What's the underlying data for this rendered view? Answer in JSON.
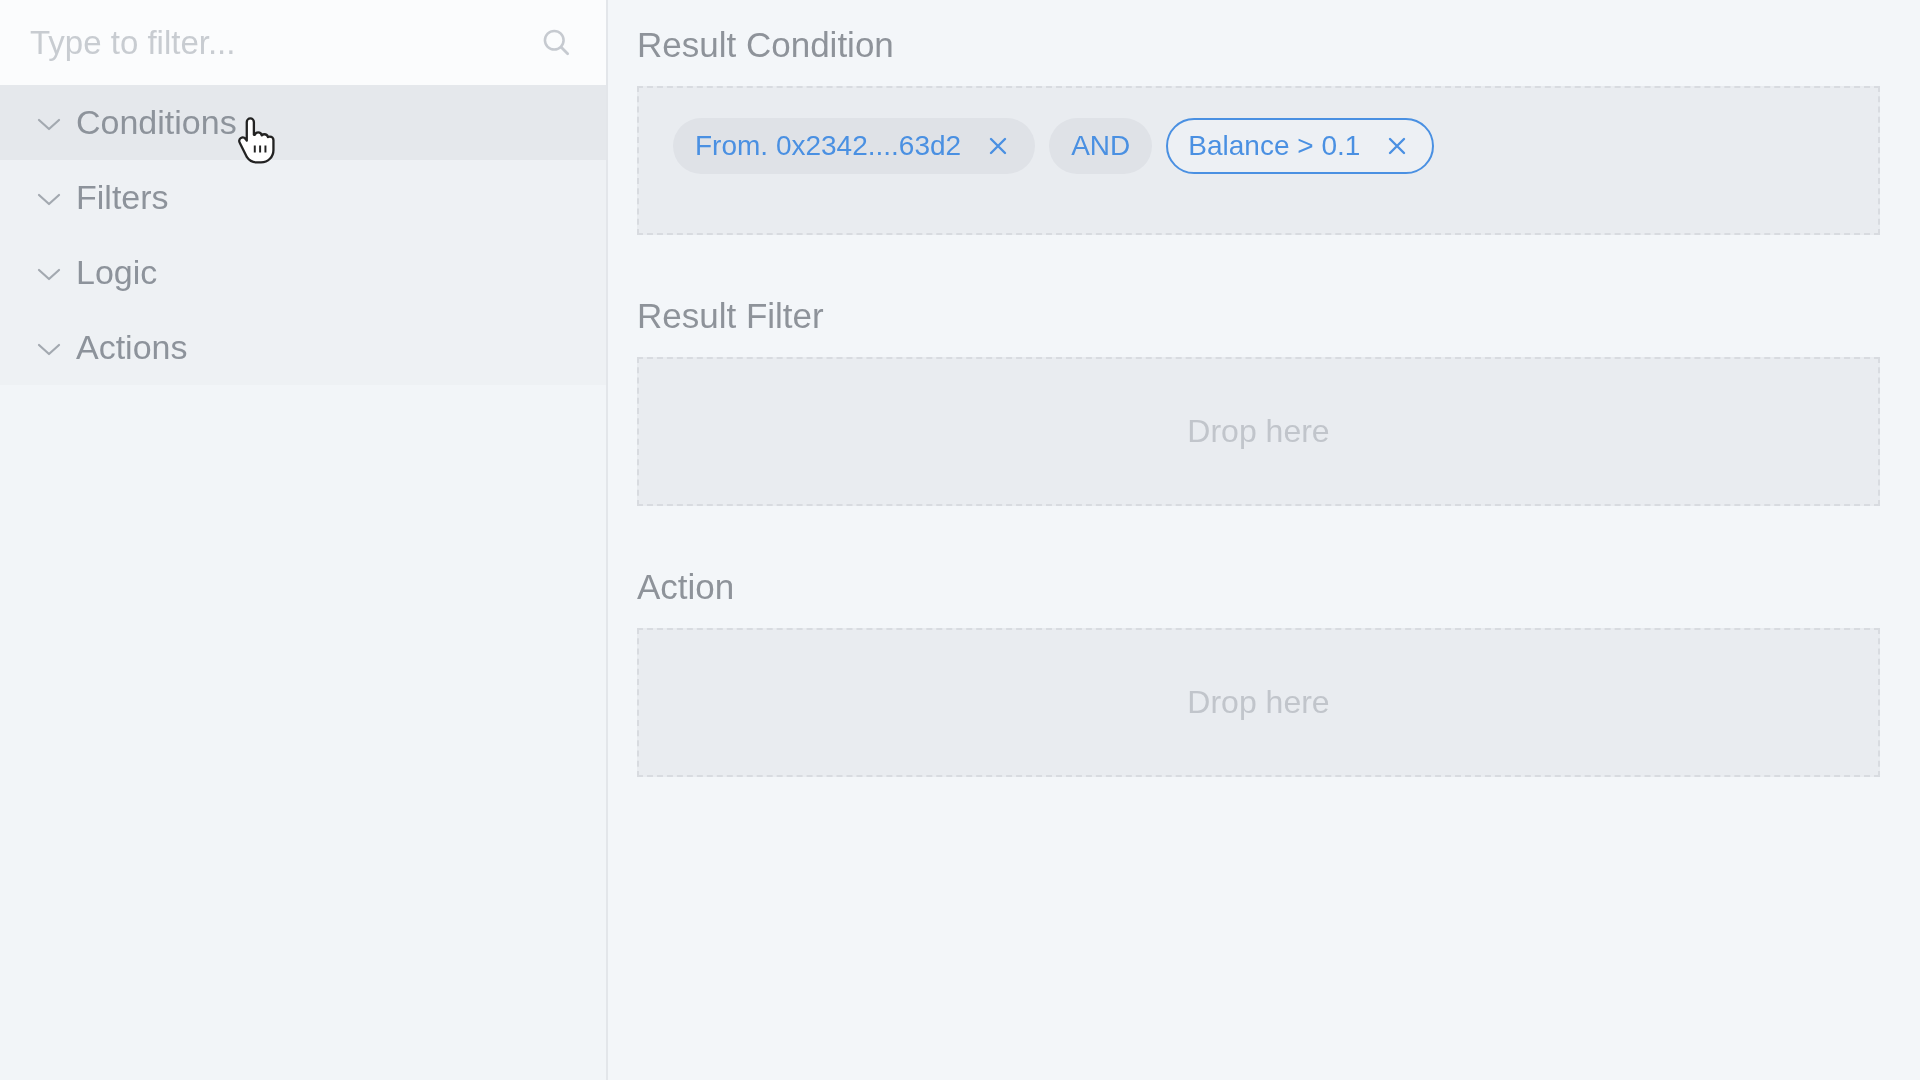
{
  "sidebar": {
    "search": {
      "placeholder": "Type to filter..."
    },
    "items": [
      {
        "label": "Conditions",
        "expanded": false,
        "hovered": true
      },
      {
        "label": "Filters",
        "expanded": false,
        "hovered": false
      },
      {
        "label": "Logic",
        "expanded": false,
        "hovered": false
      },
      {
        "label": "Actions",
        "expanded": false,
        "hovered": false
      }
    ]
  },
  "sections": [
    {
      "title": "Result Condition",
      "chips": [
        {
          "kind": "condition",
          "label": "From. 0x2342....63d2",
          "selected": false
        },
        {
          "kind": "operator",
          "label": "AND",
          "selected": false
        },
        {
          "kind": "condition",
          "label": "Balance > 0.1",
          "selected": true
        }
      ]
    },
    {
      "title": "Result Filter",
      "hint": "Drop here"
    },
    {
      "title": "Action",
      "hint": "Drop here"
    }
  ]
}
